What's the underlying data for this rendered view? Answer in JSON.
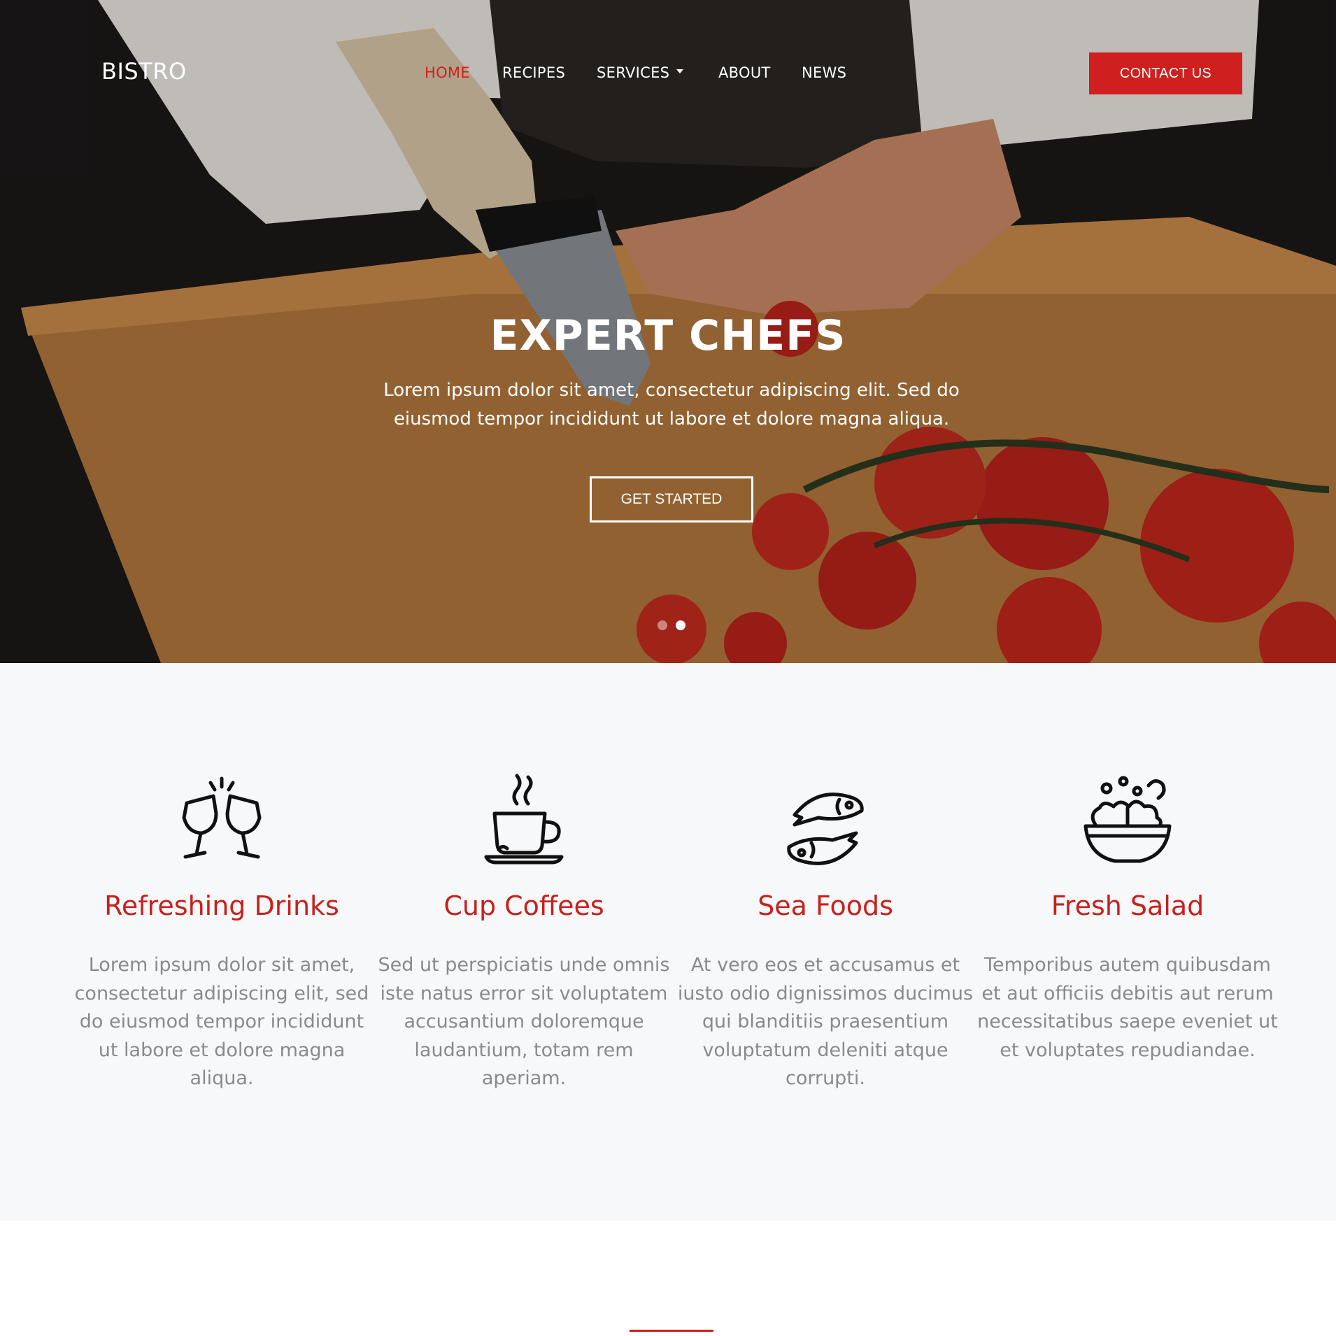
{
  "brand": "BISTRO",
  "nav": {
    "home": "HOME",
    "recipes": "RECIPES",
    "services": "SERVICES",
    "about": "ABOUT",
    "news": "NEWS",
    "contact": "CONTACT US"
  },
  "hero": {
    "title": "EXPERT CHEFS",
    "text": "Lorem ipsum dolor sit amet, consectetur adipiscing elit. Sed do eiusmod tempor incididunt ut labore et dolore magna aliqua.",
    "cta": "GET STARTED",
    "slides_total": 2,
    "slide_active": 2
  },
  "features": [
    {
      "icon": "wine-glasses-icon",
      "title": "Refreshing Drinks",
      "text": "Lorem ipsum dolor sit amet, consectetur adipiscing elit, sed do eiusmod tempor incididunt ut labore et dolore magna aliqua."
    },
    {
      "icon": "coffee-cup-icon",
      "title": "Cup Coffees",
      "text": "Sed ut perspiciatis unde omnis iste natus error sit voluptatem accusantium doloremque laudantium, totam rem aperiam."
    },
    {
      "icon": "fish-icon",
      "title": "Sea Foods",
      "text": "At vero eos et accusamus et iusto odio dignissimos ducimus qui blanditiis praesentium voluptatum deleniti atque corrupti."
    },
    {
      "icon": "salad-bowl-icon",
      "title": "Fresh Salad",
      "text": "Temporibus autem quibusdam et aut officiis debitis aut rerum necessitatibus saepe eveniet ut et voluptates repudiandae."
    }
  ],
  "colors": {
    "accent": "#d01f1f",
    "feature_title": "#c8201d",
    "feature_text": "#8a8a8a",
    "features_bg": "#f7f8fa"
  }
}
